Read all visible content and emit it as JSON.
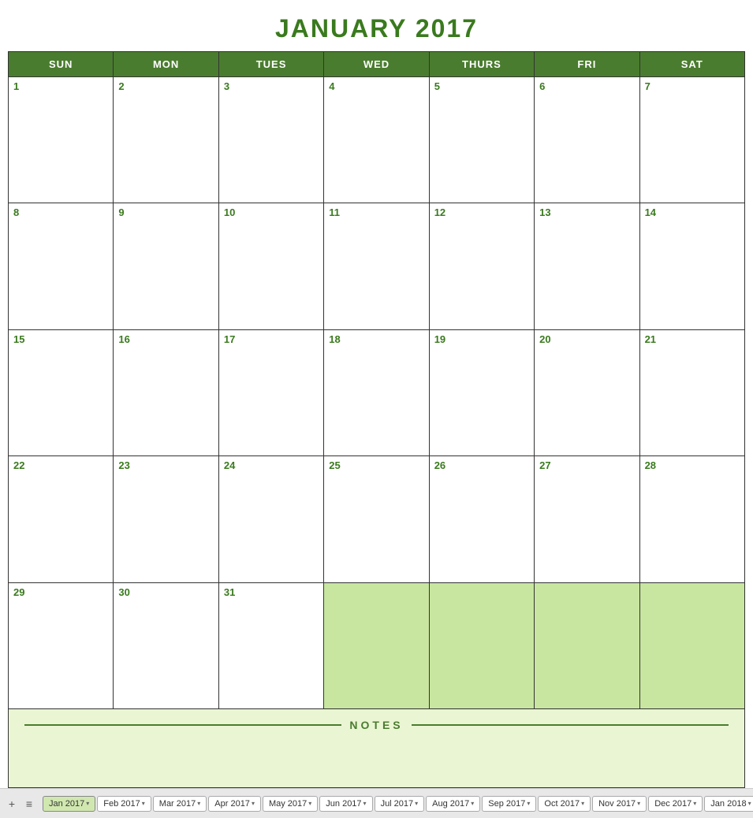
{
  "title": "JANUARY 2017",
  "headers": [
    "SUN",
    "MON",
    "TUES",
    "WED",
    "THURS",
    "FRI",
    "SAT"
  ],
  "weeks": [
    [
      {
        "day": "1",
        "empty": false
      },
      {
        "day": "2",
        "empty": false
      },
      {
        "day": "3",
        "empty": false
      },
      {
        "day": "4",
        "empty": false
      },
      {
        "day": "5",
        "empty": false
      },
      {
        "day": "6",
        "empty": false
      },
      {
        "day": "7",
        "empty": false
      }
    ],
    [
      {
        "day": "8",
        "empty": false
      },
      {
        "day": "9",
        "empty": false
      },
      {
        "day": "10",
        "empty": false
      },
      {
        "day": "11",
        "empty": false
      },
      {
        "day": "12",
        "empty": false
      },
      {
        "day": "13",
        "empty": false
      },
      {
        "day": "14",
        "empty": false
      }
    ],
    [
      {
        "day": "15",
        "empty": false
      },
      {
        "day": "16",
        "empty": false
      },
      {
        "day": "17",
        "empty": false
      },
      {
        "day": "18",
        "empty": false
      },
      {
        "day": "19",
        "empty": false
      },
      {
        "day": "20",
        "empty": false
      },
      {
        "day": "21",
        "empty": false
      }
    ],
    [
      {
        "day": "22",
        "empty": false
      },
      {
        "day": "23",
        "empty": false
      },
      {
        "day": "24",
        "empty": false
      },
      {
        "day": "25",
        "empty": false
      },
      {
        "day": "26",
        "empty": false
      },
      {
        "day": "27",
        "empty": false
      },
      {
        "day": "28",
        "empty": false
      }
    ],
    [
      {
        "day": "29",
        "empty": false
      },
      {
        "day": "30",
        "empty": false
      },
      {
        "day": "31",
        "empty": false
      },
      {
        "day": "",
        "empty": true
      },
      {
        "day": "",
        "empty": true
      },
      {
        "day": "",
        "empty": true
      },
      {
        "day": "",
        "empty": true
      }
    ]
  ],
  "notes_label": "NOTES",
  "tabs": [
    {
      "label": "Jan 2017",
      "active": true
    },
    {
      "label": "Feb 2017",
      "active": false
    },
    {
      "label": "Mar 2017",
      "active": false
    },
    {
      "label": "Apr 2017",
      "active": false
    },
    {
      "label": "May 2017",
      "active": false
    },
    {
      "label": "Jun 2017",
      "active": false
    },
    {
      "label": "Jul 2017",
      "active": false
    },
    {
      "label": "Aug 2017",
      "active": false
    },
    {
      "label": "Sep 2017",
      "active": false
    },
    {
      "label": "Oct 2017",
      "active": false
    },
    {
      "label": "Nov 2017",
      "active": false
    },
    {
      "label": "Dec 2017",
      "active": false
    },
    {
      "label": "Jan 2018",
      "active": false
    }
  ]
}
